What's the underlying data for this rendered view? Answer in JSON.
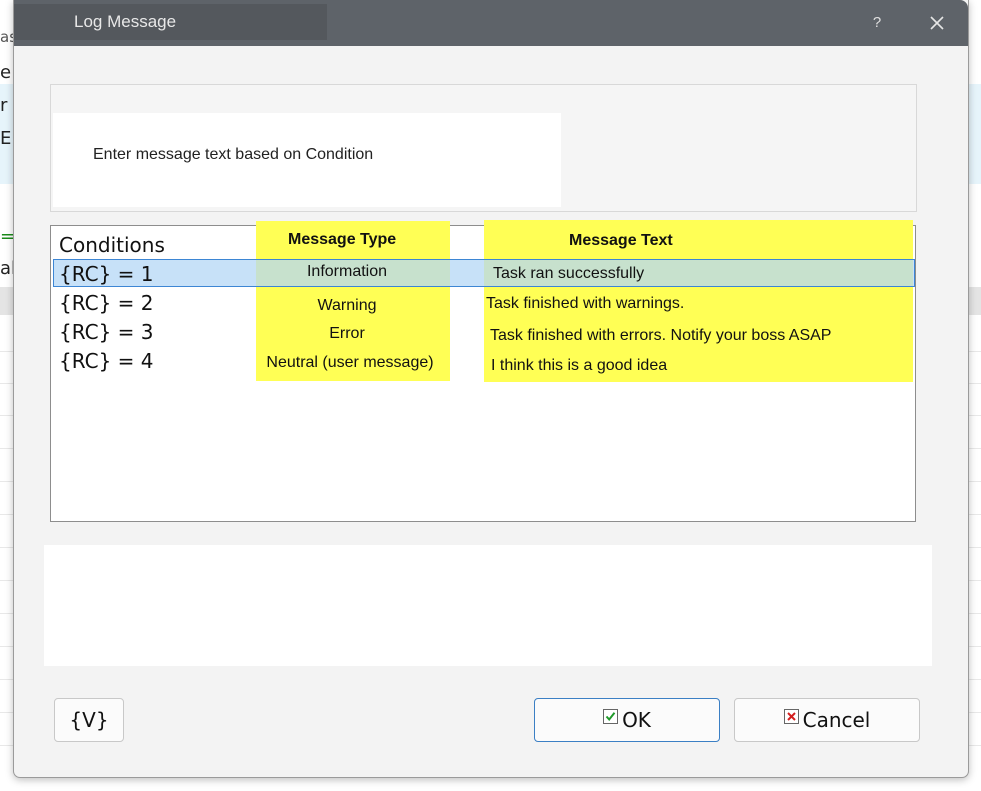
{
  "window": {
    "title": "Log Message",
    "help": "?"
  },
  "background": {
    "fragments": [
      "as",
      "e",
      "r",
      "E]",
      "=",
      "al"
    ]
  },
  "prompt": "Enter message text based on Condition",
  "table": {
    "headers": {
      "conditions": "Conditions",
      "message_type": "Message Type",
      "message_text": "Message Text"
    },
    "rows": [
      {
        "condition": "{RC} = 1",
        "type": "Information",
        "text": "Task ran successfully"
      },
      {
        "condition": "{RC} = 2",
        "type": "Warning",
        "text": "Task finished with warnings."
      },
      {
        "condition": "{RC} = 3",
        "type": "Error",
        "text": "Task finished with errors. Notify your boss ASAP"
      },
      {
        "condition": "{RC} = 4",
        "type": "Neutral (user message)",
        "text": "I think this is a good idea"
      }
    ]
  },
  "buttons": {
    "variables": "{V}",
    "ok": "OK",
    "cancel": "Cancel"
  },
  "colors": {
    "highlight": "#ffff55",
    "selection": "#b4d7f5",
    "titlebar": "#5e6369"
  }
}
